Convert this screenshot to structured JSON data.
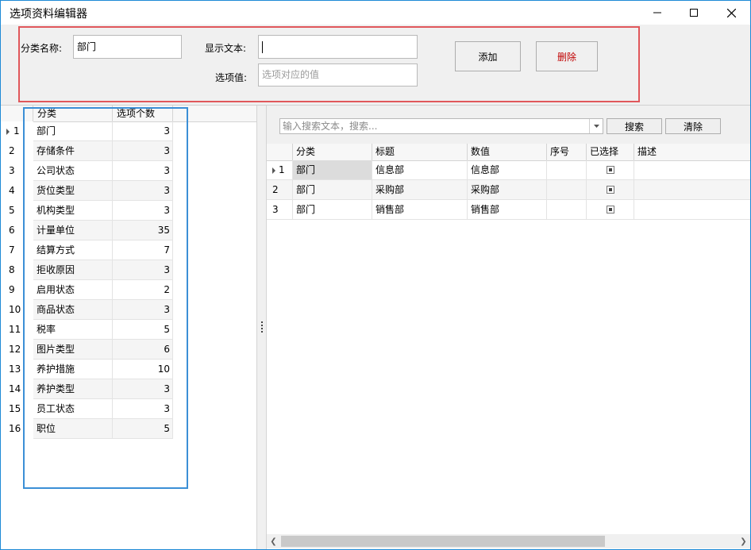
{
  "window": {
    "title": "选项资料编辑器"
  },
  "form": {
    "category_label": "分类名称:",
    "category_value": "部门",
    "display_label": "显示文本:",
    "display_value": "",
    "value_label": "选项值:",
    "value_placeholder": "选项对应的值",
    "add_label": "添加",
    "delete_label": "删除",
    "delete_color": "#c00000"
  },
  "left_grid": {
    "headers": [
      "分类",
      "选项个数"
    ],
    "rows": [
      {
        "num": "1",
        "name": "部门",
        "count": "3"
      },
      {
        "num": "2",
        "name": "存储条件",
        "count": "3"
      },
      {
        "num": "3",
        "name": "公司状态",
        "count": "3"
      },
      {
        "num": "4",
        "name": "货位类型",
        "count": "3"
      },
      {
        "num": "5",
        "name": "机构类型",
        "count": "3"
      },
      {
        "num": "6",
        "name": "计量单位",
        "count": "35"
      },
      {
        "num": "7",
        "name": "结算方式",
        "count": "7"
      },
      {
        "num": "8",
        "name": "拒收原因",
        "count": "3"
      },
      {
        "num": "9",
        "name": "启用状态",
        "count": "2"
      },
      {
        "num": "10",
        "name": "商品状态",
        "count": "3"
      },
      {
        "num": "11",
        "name": "税率",
        "count": "5"
      },
      {
        "num": "12",
        "name": "图片类型",
        "count": "6"
      },
      {
        "num": "13",
        "name": "养护措施",
        "count": "10"
      },
      {
        "num": "14",
        "name": "养护类型",
        "count": "3"
      },
      {
        "num": "15",
        "name": "员工状态",
        "count": "3"
      },
      {
        "num": "16",
        "name": "职位",
        "count": "5"
      }
    ]
  },
  "search": {
    "placeholder": "输入搜索文本，搜索...",
    "search_label": "搜索",
    "clear_label": "清除"
  },
  "right_grid": {
    "headers": [
      "分类",
      "标题",
      "数值",
      "序号",
      "已选择",
      "描述"
    ],
    "rows": [
      {
        "num": "1",
        "category": "部门",
        "title": "信息部",
        "value": "信息部",
        "order": "",
        "selected": true,
        "desc": ""
      },
      {
        "num": "2",
        "category": "部门",
        "title": "采购部",
        "value": "采购部",
        "order": "",
        "selected": true,
        "desc": ""
      },
      {
        "num": "3",
        "category": "部门",
        "title": "销售部",
        "value": "销售部",
        "order": "",
        "selected": true,
        "desc": ""
      }
    ]
  },
  "colors": {
    "highlight_red": "#e0575b",
    "highlight_blue": "#3b8fd6",
    "accent_border": "#1e8ad6"
  }
}
